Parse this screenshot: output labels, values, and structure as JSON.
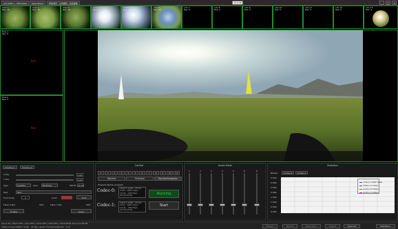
{
  "titlebar": {
    "seg1": "A10 ESM 1 - PP011008",
    "seg2": "StepViewer",
    "seg3": "新建项目 · 全景相机 · 监控面板",
    "dropdown": "4:19 VR",
    "btn_min": "_",
    "btn_max": "□",
    "btn_close": "x"
  },
  "thumbs": [
    {
      "label": "Cam 1\nRes: 4K"
    },
    {
      "label": "Cam 2\nRes: 4K"
    },
    {
      "label": "Cam 3\nRes: 4K"
    },
    {
      "label": "Cam 4\nRes: 4K"
    },
    {
      "label": "Cam 5\nRes: 4K"
    },
    {
      "label": "Cam 6\nRes: 4K"
    },
    {
      "label": "vdo-7\nRes: 0"
    },
    {
      "label": "vdo-8\nRes: 0"
    },
    {
      "label": "vdo-9\nRes: 0"
    },
    {
      "label": "vdo-10\nRes: 0"
    },
    {
      "label": "vdo-11\nRes: 0"
    },
    {
      "label": "vdo-12\nRes: 0"
    },
    {
      "label": "vdo-13\nRes: 0"
    }
  ],
  "left_previews": [
    {
      "label": "Pvw-1\nRes: 0",
      "center": "Res"
    },
    {
      "label": "Pvw-2\nRes: 0",
      "center": "Res"
    }
  ],
  "overlay_panel": {
    "tab1": "Overlay-1",
    "tab2": "Overlay-2",
    "x_pos": "X Pos",
    "y_pos": "Y Pos",
    "x_val": "0.00",
    "y_val": "0.00",
    "type_label": "Type",
    "type_value": "Subtitle",
    "lens_label": "Lens",
    "lens_value": "BirdView",
    "width_label": "WDTH",
    "width_value": "45.00",
    "text_label": "Text",
    "text_value": "Text",
    "font_scale_label": "Font Scale",
    "font_scale_value": "0",
    "color_label": "Color",
    "font_label": "Font",
    "flash_x_label": "Flash X Pos",
    "flash_x_value": "50%",
    "flash_y_label": "Flash Y Pos",
    "flash_y_value": "50%",
    "enable_btn": "Enable",
    "apply_btn": "Apply",
    "color_accent": "#d21f1f"
  },
  "control": {
    "title": "Control",
    "numbers": [
      "0",
      "1",
      "2",
      "3",
      "4",
      "5",
      "6",
      "7",
      "8",
      "9",
      "10",
      "11"
    ],
    "tab_sphere": "Sphere",
    "tab_preview": "Preview",
    "tab_equirect": "Equirectangular",
    "program_label": "Program Name: program",
    "codec0": "Codec-0:",
    "codec1": "Codec-1:",
    "codec0_info": "2560 X 1440 - 25 fps\nh264 - 8000 Kbps\nmp4a - 128 Kbps\n00:00:00:00",
    "codec1_info": "1920 X 1080 - 25 fps\nh264 - 6000 Kbps\nmp4a - 128 Kbps\n00:00:00:00",
    "running_btn": "Running",
    "start_btn": "Start",
    "running_color": "#2fd24a"
  },
  "audio_mixer": {
    "title": "Audio Mixer",
    "channels": [
      "1",
      "2",
      "3",
      "4",
      "5",
      "6",
      "P"
    ]
  },
  "statistics": {
    "title": "Statistics",
    "bitrate_label": "Bitrate",
    "codec_tab0": "Codec-0",
    "codec_tab1": "Codec-1",
    "y_ticks": [
      "3.500",
      "3.000",
      "2.500",
      "2.000",
      "1.500",
      "1.000",
      "0.500",
      "0.000"
    ],
    "legend": [
      {
        "name": "Video-0 2560 Kbps",
        "color": "#2244cc"
      },
      {
        "name": "Video-1 0 Kbps",
        "color": "#cc2222"
      },
      {
        "name": "Audio-0 0 Kbps",
        "color": "#22aa22"
      },
      {
        "name": "Audio-1 0 Kbps",
        "color": "#aa22aa"
      }
    ]
  },
  "statusbar": {
    "line1": "Cpu:14% | Mem:29% | Gpu:45% | Gme:30% | Dsk:23% | Time:2016-10-12 11:55:36",
    "line2": "Video Format:2560 X 1440 - 25 fps | Audio Format:44100 Hz - 2 ch",
    "btn_stream": "Stream",
    "btn_record": "Record",
    "btn_panoramic": "Panoramic",
    "btn_output": "Output",
    "btn_optimize": "Optimize",
    "btn_mainmenu": "MainMenu"
  }
}
